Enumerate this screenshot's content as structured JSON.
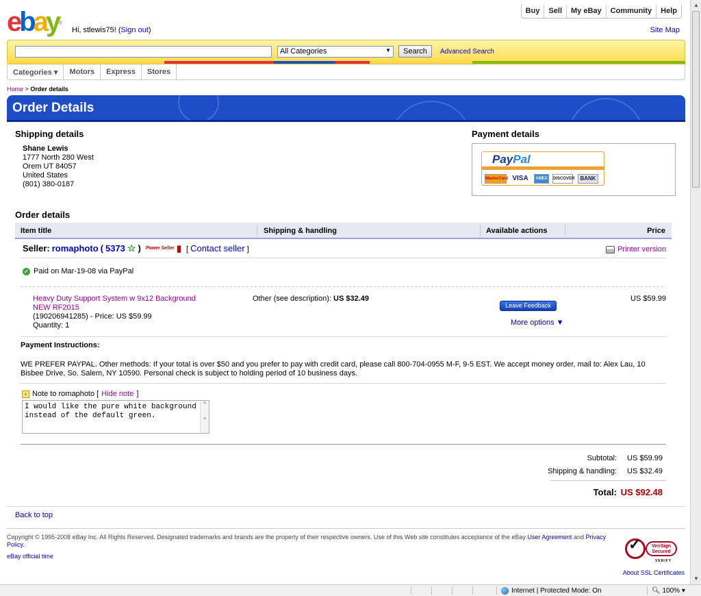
{
  "header": {
    "logo_letters": [
      "e",
      "b",
      "a",
      "y"
    ],
    "greeting_prefix": "Hi, stlewis75! (",
    "sign_out": "Sign out",
    "greeting_suffix": ")",
    "top_nav": [
      "Buy",
      "Sell",
      "My eBay",
      "Community",
      "Help"
    ],
    "site_map": "Site Map"
  },
  "search": {
    "input_value": "",
    "category": "All Categories",
    "button": "Search",
    "advanced": "Advanced Search"
  },
  "sub_nav": [
    "Categories ▾",
    "Motors",
    "Express",
    "Stores"
  ],
  "breadcrumb": {
    "home": "Home",
    "separator": ">",
    "current": "Order details"
  },
  "page_title": "Order Details",
  "shipping": {
    "title": "Shipping details",
    "name": "Shane Lewis",
    "street": "1777 North 280 West",
    "city": "Orem UT 84057",
    "country": "United States",
    "phone": "(801) 380-0187"
  },
  "payment": {
    "title": "Payment details",
    "paypal_pay": "Pay",
    "paypal_pal": "Pal",
    "cards": [
      "MasterCard",
      "VISA",
      "AMEX",
      "DISCOVER",
      "BANK"
    ]
  },
  "order": {
    "title": "Order details",
    "columns": [
      "Item title",
      "Shipping & handling",
      "Available actions",
      "Price"
    ],
    "seller_label": "Seller:",
    "seller_name": "romaphoto",
    "feedback_open": "(",
    "feedback_score": "5373",
    "feedback_close": ")",
    "power_seller": "Power Seller",
    "contact_open": "[",
    "contact_seller": "Contact seller",
    "contact_close": "]",
    "printer_version": "Printer version",
    "paid_status": "Paid on Mar-19-08 via PayPal",
    "item": {
      "title": "Heavy Duty Support System w 9x12 Background NEW RF2015",
      "id_price": "(190206941285) - Price: US $59.99",
      "quantity": "Quantity: 1",
      "shipping_label": "Other (see description):",
      "shipping_cost": "US $32.49",
      "price": "US $59.99"
    },
    "leave_feedback": "Leave Feedback",
    "more_options": "More options ▼"
  },
  "instructions": {
    "title": "Payment Instructions:",
    "text": "WE PREFER PAYPAL. Other methods: If your total is over $50 and you prefer to pay with credit card, please call 800-704-0955 M-F, 9-5 EST. We accept money order, mail to: Alex Lau, 10 Bisbee Drive, So. Salem, NY 10590. Personal check is subject to holding period of 10 business days."
  },
  "note": {
    "label": "Note to romaphoto [",
    "hide": "Hide note",
    "label_close": "]",
    "text": "I would like the pure white background instead of the default green."
  },
  "summary": {
    "subtotal_label": "Subtotal:",
    "subtotal": "US $59.99",
    "shipping_label": "Shipping & handling:",
    "shipping": "US $32.49",
    "total_label": "Total:",
    "total": "US $92.48"
  },
  "footer": {
    "back_to_top": "Back to top",
    "copyright": "Copyright © 1995-2008 eBay Inc. All Rights Reserved. Designated trademarks and brands are the property of their respective owners. Use of this Web site constitutes acceptance of the eBay",
    "user_agreement": "User Agreement",
    "and": "and",
    "privacy": "Privacy Policy",
    "official_time": "eBay official time",
    "verisign_badge": "VeriSign Secured",
    "verisign_verify": "VERIFY",
    "ssl": "About SSL Certificates"
  },
  "statusbar": {
    "zone": "Internet | Protected Mode: On",
    "zoom": "100%"
  },
  "colors": {
    "ebay_red": "#e53238",
    "ebay_blue": "#0064d2",
    "ebay_yellow": "#f5af02",
    "ebay_green": "#86b817",
    "banner_blue": "#1d4ec8",
    "total_red": "#b00000",
    "link_purple": "#990099"
  }
}
